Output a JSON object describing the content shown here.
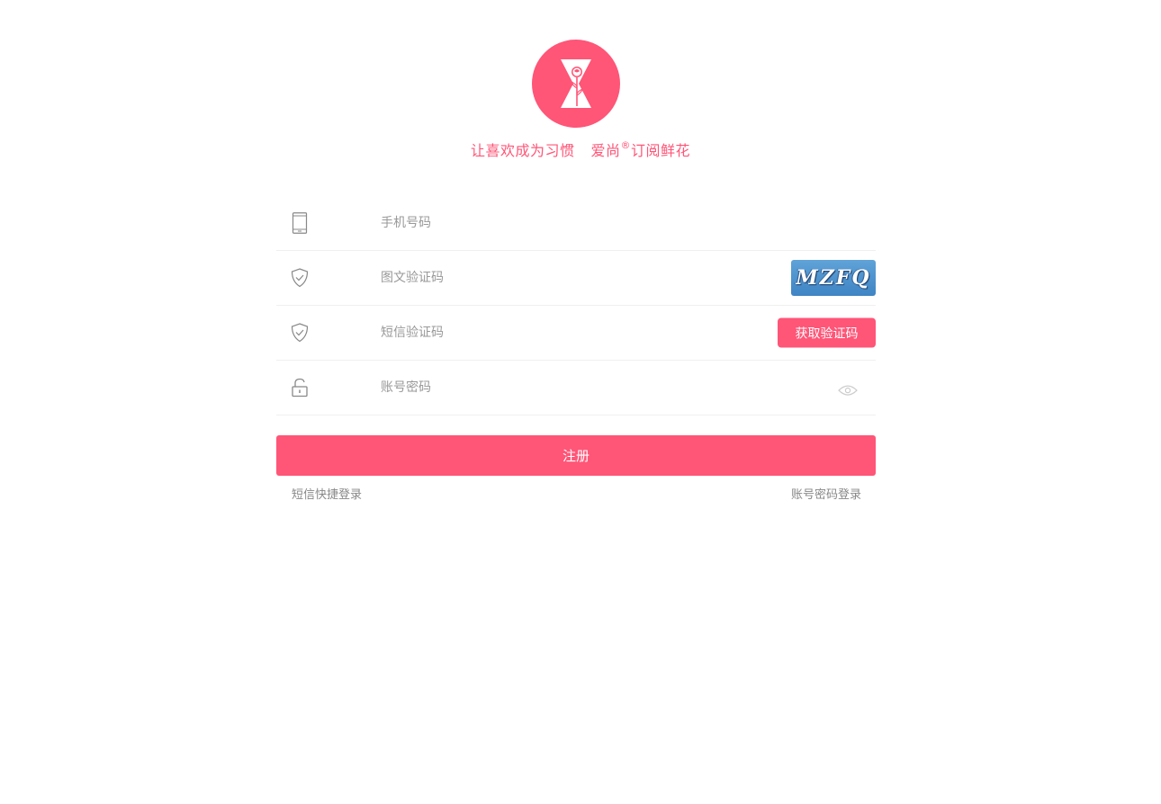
{
  "brand": {
    "logo_icon": "rose-hourglass-logo-icon",
    "accent_color": "#ff5577",
    "slogan_part1": "让喜欢成为习惯",
    "slogan_part2a": "爱尚",
    "slogan_registered": "®",
    "slogan_part2b": "订阅鲜花"
  },
  "form": {
    "phone": {
      "icon": "mobile-phone-icon",
      "placeholder": "手机号码",
      "value": ""
    },
    "image_captcha": {
      "icon": "shield-check-icon",
      "placeholder": "图文验证码",
      "value": "",
      "captcha_text": "MZFQ"
    },
    "sms_code": {
      "icon": "shield-check-icon",
      "placeholder": "短信验证码",
      "value": "",
      "button_label": "获取验证码"
    },
    "password": {
      "icon": "unlock-icon",
      "placeholder": "账号密码",
      "value": "",
      "toggle_icon": "eye-icon"
    },
    "submit_label": "注册"
  },
  "links": {
    "sms_login": "短信快捷登录",
    "password_login": "账号密码登录"
  }
}
